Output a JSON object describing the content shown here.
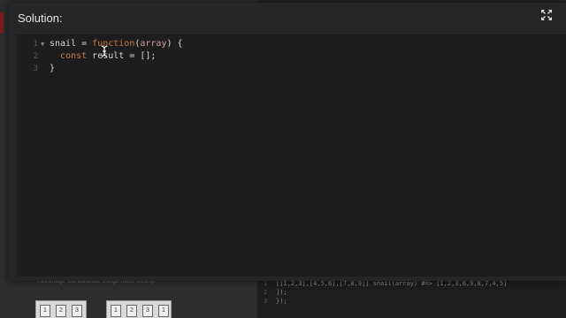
{
  "modal": {
    "title": "Solution:",
    "expand_icon": "expand-arrows-icon"
  },
  "editor": {
    "lines": [
      {
        "number": "1",
        "foldable": true,
        "tokens": [
          {
            "type": "plain",
            "text": "snail = "
          },
          {
            "type": "kw",
            "text": "function"
          },
          {
            "type": "plain",
            "text": "("
          },
          {
            "type": "param",
            "text": "array"
          },
          {
            "type": "plain",
            "text": ") {"
          }
        ]
      },
      {
        "number": "2",
        "foldable": false,
        "tokens": [
          {
            "type": "plain",
            "text": "  "
          },
          {
            "type": "kw",
            "text": "const"
          },
          {
            "type": "plain",
            "text": " result = [];"
          }
        ]
      },
      {
        "number": "3",
        "foldable": false,
        "tokens": [
          {
            "type": "plain",
            "text": "}"
          }
        ]
      }
    ],
    "cursor_icon": "text-cursor-icon"
  },
  "background": {
    "hint_text": "This image will illustrate things more clearly:",
    "diagram_a": [
      "1",
      "2",
      "3"
    ],
    "diagram_b": [
      "1",
      "2",
      "3",
      "1"
    ],
    "code_lines": [
      {
        "number": "1",
        "text": "[[1,2,3],[4,5,6],[7,8,9]]  snail(array) #=> [1,2,3,6,9,8,7,4,5]"
      },
      {
        "number": "2",
        "text": "]);"
      },
      {
        "number": "3",
        "text": "});"
      }
    ]
  },
  "colors": {
    "modal_bg": "#262626",
    "editor_bg": "#1d1d1d",
    "keyword": "#cc7a43",
    "param": "#d6a0a0"
  }
}
